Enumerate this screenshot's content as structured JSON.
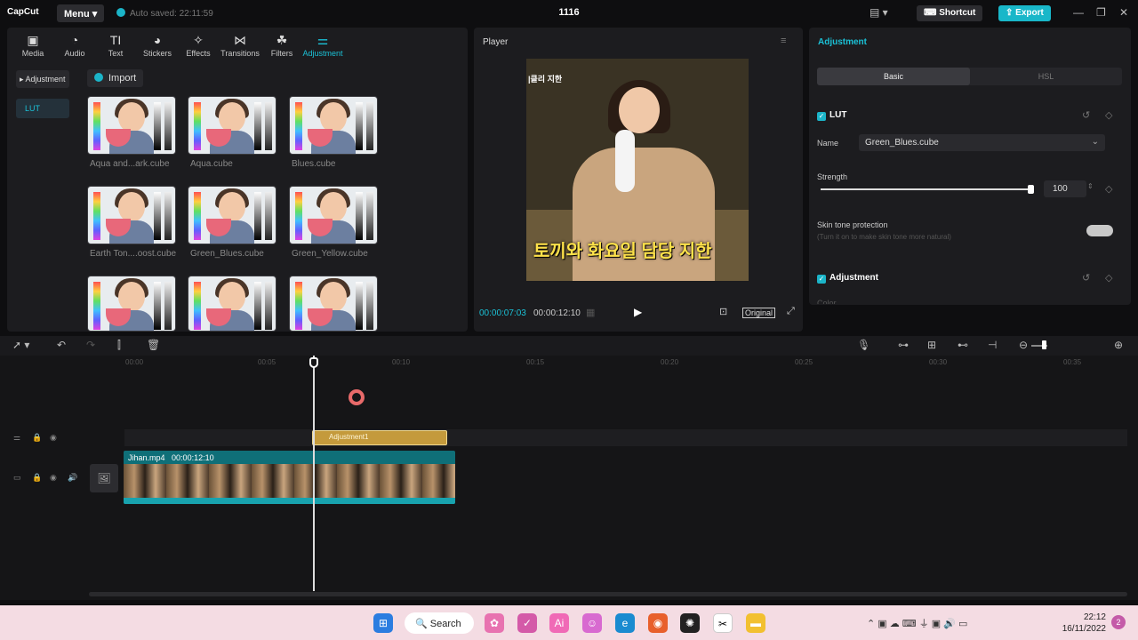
{
  "app": {
    "logo": "CapCut",
    "menu_label": "Menu",
    "autosave": "Auto saved: 22:11:59",
    "project_title": "1116",
    "shortcut_label": "Shortcut",
    "export_label": "Export"
  },
  "media_toolbar": {
    "items": [
      {
        "label": "Media",
        "icon": "media-icon"
      },
      {
        "label": "Audio",
        "icon": "audio-icon"
      },
      {
        "label": "Text",
        "icon": "text-icon"
      },
      {
        "label": "Stickers",
        "icon": "sticker-icon"
      },
      {
        "label": "Effects",
        "icon": "effects-icon"
      },
      {
        "label": "Transitions",
        "icon": "transitions-icon"
      },
      {
        "label": "Filters",
        "icon": "filters-icon"
      },
      {
        "label": "Adjustment",
        "icon": "adjustment-icon"
      }
    ],
    "active": "Adjustment"
  },
  "sidebar": {
    "adjustment_label": "Adjustment",
    "lut_label": "LUT"
  },
  "library": {
    "import_label": "Import",
    "items": [
      "Aqua and...ark.cube",
      "Aqua.cube",
      "Blues.cube",
      "Earth Ton....oost.cube",
      "Green_Blues.cube",
      "Green_Yellow.cube",
      "",
      "",
      ""
    ]
  },
  "player": {
    "title": "Player",
    "caption_top": "|클리 지한",
    "caption_bottom": "토끼와 화요일 담당 지한",
    "current_time": "00:00:07:03",
    "total_time": "00:00:12:10",
    "ratio_label": "Original"
  },
  "adjustment_panel": {
    "title": "Adjustment",
    "tabs": [
      "Basic",
      "HSL"
    ],
    "lut_section": "LUT",
    "name_label": "Name",
    "name_value": "Green_Blues.cube",
    "strength_label": "Strength",
    "strength_value": "100",
    "strength_level": 1.0,
    "skin_label": "Skin tone protection",
    "skin_hint": "Turn it on to make skin tone more natural",
    "adjustment_section": "Adjustment",
    "color_label": "Color"
  },
  "timeline": {
    "ticks": [
      "00:00",
      "00:05",
      "00:10",
      "00:15",
      "00:20",
      "00:25",
      "00:30",
      "00:35"
    ],
    "adjustment_clip": "Adjustment1",
    "video_clip_name": "Jihan.mp4",
    "video_clip_duration": "00:00:12:10"
  },
  "taskbar": {
    "search_label": "Search",
    "time": "22:12",
    "date": "16/11/2022"
  },
  "colors": {
    "accent": "#1bc1d6",
    "adjust_clip": "#c49a3c",
    "video_clip": "#0f6f78"
  }
}
